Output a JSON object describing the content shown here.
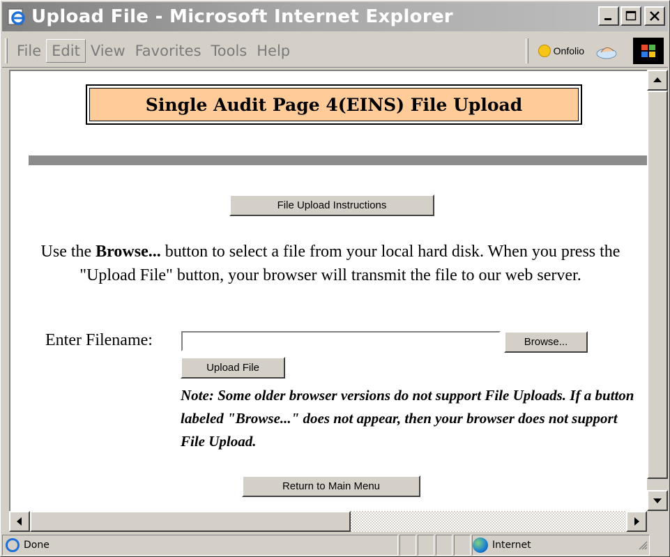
{
  "window": {
    "title": "Upload File - Microsoft Internet Explorer"
  },
  "menu": {
    "items": [
      "File",
      "Edit",
      "View",
      "Favorites",
      "Tools",
      "Help"
    ],
    "onfolio_label": "Onfolio"
  },
  "page": {
    "banner_title": "Single Audit Page 4(EINS) File Upload",
    "instructions_button": "File Upload Instructions",
    "para_text_1": "Use the ",
    "para_bold": "Browse...",
    "para_text_2": " button to select a file from your local hard disk. When you press the \"Upload File\" button, your browser will transmit the file to our web server.",
    "filename_label": "Enter Filename:",
    "filename_value": "",
    "browse_button": "Browse...",
    "upload_button": "Upload File",
    "note": "Note: Some older browser versions do not support File Uploads. If a button labeled \"Browse...\" does not appear, then your browser does not support File Upload.",
    "return_button": "Return to Main Menu"
  },
  "status": {
    "text": "Done",
    "zone": "Internet"
  },
  "colors": {
    "banner_bg": "#ffcc99",
    "titlebar_start": "#808080",
    "titlebar_end": "#c0c0c0",
    "rule": "#8c8c8c"
  }
}
